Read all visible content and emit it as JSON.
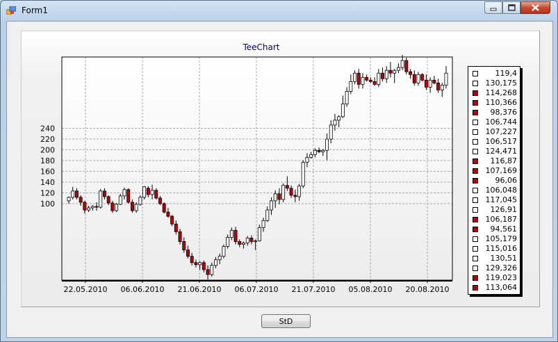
{
  "window": {
    "title": "Form1",
    "minimize_icon": "minimize-icon",
    "maximize_icon": "maximize-icon",
    "close_icon": "close-icon"
  },
  "button": {
    "label": "StD"
  },
  "colors": {
    "up": "#ffffff",
    "down": "#c00000",
    "title": "#000080"
  },
  "legend": [
    {
      "text": "119,4",
      "dir": "up"
    },
    {
      "text": "130,175",
      "dir": "up"
    },
    {
      "text": "114,268",
      "dir": "down"
    },
    {
      "text": "110,366",
      "dir": "down"
    },
    {
      "text": "98,376",
      "dir": "down"
    },
    {
      "text": "106,744",
      "dir": "up"
    },
    {
      "text": "107,227",
      "dir": "up"
    },
    {
      "text": "106,517",
      "dir": "up"
    },
    {
      "text": "124,471",
      "dir": "up"
    },
    {
      "text": "116,87",
      "dir": "down"
    },
    {
      "text": "107,169",
      "dir": "down"
    },
    {
      "text": "96,06",
      "dir": "down"
    },
    {
      "text": "106,048",
      "dir": "up"
    },
    {
      "text": "117,045",
      "dir": "up"
    },
    {
      "text": "126,91",
      "dir": "up"
    },
    {
      "text": "106,187",
      "dir": "down"
    },
    {
      "text": "94,561",
      "dir": "down"
    },
    {
      "text": "105,179",
      "dir": "up"
    },
    {
      "text": "115,016",
      "dir": "up"
    },
    {
      "text": "130,51",
      "dir": "up"
    },
    {
      "text": "129,326",
      "dir": "up"
    },
    {
      "text": "119,023",
      "dir": "down"
    },
    {
      "text": "113,064",
      "dir": "down"
    }
  ],
  "chart_data": {
    "type": "candlestick",
    "title": "TeeChart",
    "y_ticks": [
      "100",
      "120",
      "140",
      "160",
      "180",
      "200",
      "220",
      "240"
    ],
    "x_ticks": [
      "22.05.2010",
      "06.06.2010",
      "21.06.2010",
      "06.07.2010",
      "21.07.2010",
      "05.08.2010",
      "20.08.2010"
    ],
    "ylim": [
      -3,
      315
    ],
    "grid": true,
    "ohlc": [
      [
        110,
        116,
        106,
        115
      ],
      [
        115,
        130,
        112,
        124
      ],
      [
        124,
        128,
        112,
        115
      ],
      [
        115,
        118,
        103,
        108
      ],
      [
        108,
        110,
        92,
        97
      ],
      [
        97,
        103,
        94,
        100
      ],
      [
        100,
        104,
        96,
        102
      ],
      [
        102,
        108,
        96,
        101
      ],
      [
        101,
        127,
        99,
        124
      ],
      [
        124,
        128,
        112,
        116
      ],
      [
        116,
        118,
        104,
        107
      ],
      [
        107,
        110,
        93,
        96
      ],
      [
        96,
        107,
        94,
        105
      ],
      [
        105,
        120,
        104,
        117
      ],
      [
        117,
        129,
        112,
        126
      ],
      [
        126,
        128,
        106,
        108
      ],
      [
        108,
        112,
        93,
        96
      ],
      [
        96,
        108,
        93,
        105
      ],
      [
        105,
        118,
        103,
        115
      ],
      [
        115,
        131,
        112,
        130
      ],
      [
        128,
        131,
        115,
        119
      ],
      [
        119,
        133,
        112,
        125
      ],
      [
        125,
        128,
        112,
        114
      ],
      [
        114,
        117,
        104,
        106
      ],
      [
        106,
        108,
        92,
        94
      ],
      [
        94,
        100,
        86,
        88
      ],
      [
        88,
        90,
        74,
        77
      ],
      [
        77,
        82,
        62,
        66
      ],
      [
        66,
        70,
        48,
        52
      ],
      [
        52,
        58,
        36,
        40
      ],
      [
        40,
        46,
        28,
        31
      ],
      [
        31,
        36,
        18,
        22
      ],
      [
        22,
        26,
        15,
        19
      ],
      [
        19,
        24,
        12,
        22
      ],
      [
        22,
        25,
        8,
        12
      ],
      [
        12,
        18,
        -2,
        5
      ],
      [
        5,
        22,
        2,
        18
      ],
      [
        18,
        30,
        14,
        26
      ],
      [
        26,
        35,
        20,
        31
      ],
      [
        31,
        48,
        28,
        45
      ],
      [
        45,
        62,
        42,
        58
      ],
      [
        58,
        72,
        54,
        68
      ],
      [
        68,
        73,
        48,
        52
      ],
      [
        52,
        55,
        44,
        48
      ],
      [
        48,
        52,
        42,
        50
      ],
      [
        50,
        60,
        46,
        57
      ],
      [
        57,
        61,
        48,
        52
      ],
      [
        52,
        55,
        40,
        53
      ],
      [
        53,
        76,
        52,
        72
      ],
      [
        72,
        86,
        66,
        82
      ],
      [
        82,
        102,
        80,
        97
      ],
      [
        97,
        115,
        90,
        110
      ],
      [
        110,
        125,
        100,
        120
      ],
      [
        120,
        128,
        105,
        112
      ],
      [
        112,
        135,
        108,
        132
      ],
      [
        132,
        145,
        124,
        128
      ],
      [
        128,
        132,
        114,
        118
      ],
      [
        118,
        126,
        108,
        116
      ],
      [
        116,
        134,
        110,
        131
      ],
      [
        131,
        168,
        128,
        165
      ],
      [
        165,
        178,
        158,
        172
      ],
      [
        172,
        180,
        170,
        176
      ],
      [
        176,
        185,
        172,
        182
      ],
      [
        182,
        186,
        178,
        180
      ],
      [
        180,
        184,
        174,
        182
      ],
      [
        182,
        206,
        168,
        198
      ],
      [
        198,
        225,
        192,
        218
      ],
      [
        218,
        234,
        210,
        225
      ],
      [
        225,
        232,
        215,
        230
      ],
      [
        230,
        260,
        228,
        248
      ],
      [
        248,
        272,
        244,
        266
      ],
      [
        266,
        290,
        262,
        280
      ],
      [
        280,
        296,
        276,
        292
      ],
      [
        292,
        298,
        270,
        276
      ],
      [
        276,
        292,
        270,
        286
      ],
      [
        286,
        290,
        280,
        282
      ],
      [
        282,
        286,
        278,
        280
      ],
      [
        280,
        286,
        274,
        276
      ],
      [
        276,
        298,
        272,
        292
      ],
      [
        292,
        300,
        280,
        284
      ],
      [
        284,
        302,
        278,
        296
      ],
      [
        296,
        308,
        286,
        292
      ],
      [
        292,
        298,
        278,
        296
      ],
      [
        296,
        306,
        292,
        300
      ],
      [
        300,
        318,
        296,
        310
      ],
      [
        310,
        314,
        290,
        294
      ],
      [
        294,
        298,
        284,
        290
      ],
      [
        290,
        296,
        274,
        278
      ],
      [
        278,
        294,
        274,
        290
      ],
      [
        290,
        292,
        280,
        282
      ],
      [
        282,
        290,
        268,
        272
      ],
      [
        272,
        286,
        264,
        282
      ],
      [
        282,
        288,
        276,
        278
      ],
      [
        278,
        284,
        264,
        268
      ],
      [
        268,
        278,
        258,
        275
      ],
      [
        275,
        302,
        270,
        292
      ]
    ]
  }
}
